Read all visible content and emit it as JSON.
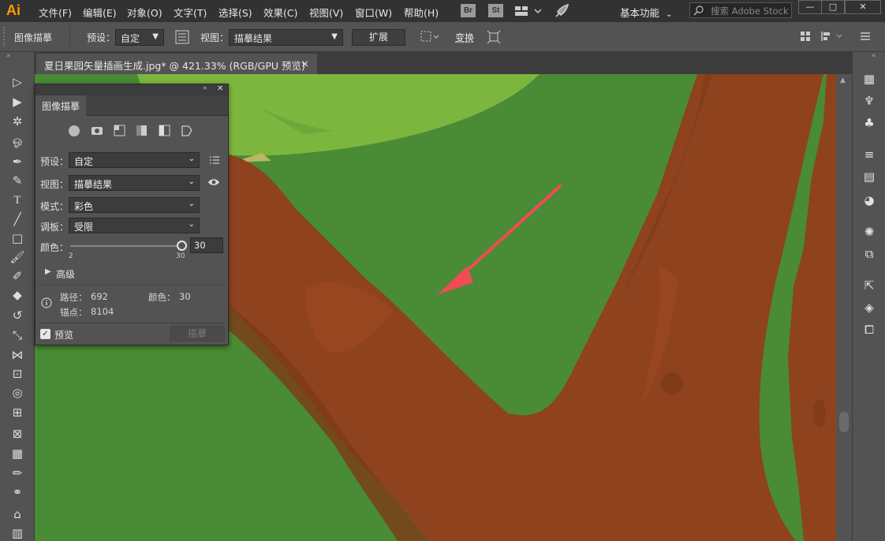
{
  "app": {
    "logo": "Ai"
  },
  "menubar": {
    "items": [
      "文件(F)",
      "编辑(E)",
      "对象(O)",
      "文字(T)",
      "选择(S)",
      "效果(C)",
      "视图(V)",
      "窗口(W)",
      "帮助(H)"
    ],
    "br_label": "Br",
    "st_label": "St",
    "workspace": "基本功能",
    "search_placeholder": "搜索 Adobe Stock"
  },
  "control_bar": {
    "panel_label": "图像描摹",
    "preset_label": "预设：",
    "preset_value": "自定",
    "view_label": "视图：",
    "view_value": "描摹结果",
    "expand_button": "扩展",
    "transform_button": "变换"
  },
  "document_tab": {
    "title": "夏日果园矢量插画生成.jpg* @ 421.33% (RGB/GPU 预览)",
    "close": "×"
  },
  "trace_panel": {
    "title": "图像描摹",
    "preset_label": "预设：",
    "preset_value": "自定",
    "view_label": "视图：",
    "view_value": "描摹结果",
    "mode_label": "模式：",
    "mode_value": "彩色",
    "palette_label": "调板：",
    "palette_value": "受限",
    "colors_label": "颜色：",
    "colors_value": "30",
    "colors_slider_fraction": 1.0,
    "slider_min_label": "2",
    "slider_max_label": "30",
    "advanced_label": "高级",
    "paths_label": "路径：",
    "paths_value": "692",
    "colors_info_label": "颜色：",
    "colors_info_value": "30",
    "anchors_label": "锚点：",
    "anchors_value": "8104",
    "preview_label": "预览",
    "preview_checked": true,
    "trace_button": "描摹"
  },
  "colors": {
    "canvas_green": "#4a8b35",
    "light_green": "#7db63f",
    "trunk_brown": "#8e421e",
    "arrow_red": "#f04c55",
    "chrome_dark": "#323232",
    "chrome_mid": "#535353"
  }
}
